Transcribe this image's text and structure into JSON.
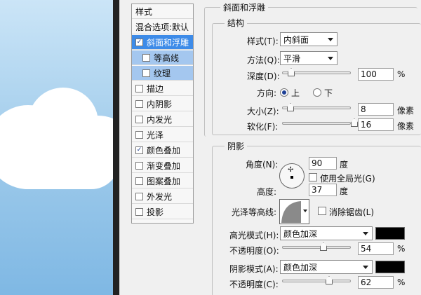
{
  "styles_panel": {
    "header": "样式",
    "blend_options": "混合选项:默认",
    "items": [
      {
        "label": "斜面和浮雕",
        "checked": true,
        "selected": true
      },
      {
        "label": "等高线",
        "checked": false,
        "sub": true
      },
      {
        "label": "纹理",
        "checked": false,
        "sub": true
      },
      {
        "label": "描边",
        "checked": false
      },
      {
        "label": "内阴影",
        "checked": false
      },
      {
        "label": "内发光",
        "checked": false
      },
      {
        "label": "光泽",
        "checked": false
      },
      {
        "label": "颜色叠加",
        "checked": true
      },
      {
        "label": "渐变叠加",
        "checked": false
      },
      {
        "label": "图案叠加",
        "checked": false
      },
      {
        "label": "外发光",
        "checked": false
      },
      {
        "label": "投影",
        "checked": false
      }
    ]
  },
  "bevel": {
    "title": "斜面和浮雕",
    "structure_title": "结构",
    "style_label": "样式(T):",
    "style_value": "内斜面",
    "technique_label": "方法(Q):",
    "technique_value": "平滑",
    "depth_label": "深度(D):",
    "depth_value": "100",
    "depth_unit": "%",
    "direction_label": "方向:",
    "dir_up": "上",
    "dir_down": "下",
    "size_label": "大小(Z):",
    "size_value": "8",
    "size_unit": "像素",
    "soften_label": "软化(F):",
    "soften_value": "16",
    "soften_unit": "像素"
  },
  "shading": {
    "title": "阴影",
    "angle_label": "角度(N):",
    "angle_value": "90",
    "angle_unit": "度",
    "global_light_label": "使用全局光(G)",
    "altitude_label": "高度:",
    "altitude_value": "37",
    "altitude_unit": "度",
    "gloss_contour_label": "光泽等高线:",
    "antialias_label": "消除锯齿(L)",
    "highlight_mode_label": "高光模式(H):",
    "highlight_mode_value": "颜色加深",
    "highlight_color": "#000000",
    "opacity1_label": "不透明度(O):",
    "opacity1_value": "54",
    "opacity1_unit": "%",
    "shadow_mode_label": "阴影模式(A):",
    "shadow_mode_value": "颜色加深",
    "shadow_color": "#000000",
    "opacity2_label": "不透明度(C):",
    "opacity2_value": "62",
    "opacity2_unit": "%"
  }
}
